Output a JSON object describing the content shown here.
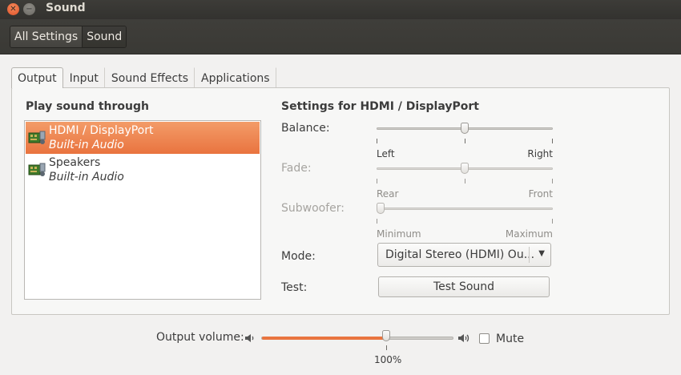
{
  "window": {
    "title": "Sound"
  },
  "breadcrumbs": [
    {
      "label": "All Settings"
    },
    {
      "label": "Sound"
    }
  ],
  "tabs": [
    {
      "label": "Output",
      "selected": true
    },
    {
      "label": "Input",
      "selected": false
    },
    {
      "label": "Sound Effects",
      "selected": false
    },
    {
      "label": "Applications",
      "selected": false
    }
  ],
  "output": {
    "device_heading": "Play sound through",
    "devices": [
      {
        "name": "HDMI / DisplayPort",
        "sub": "Built-in Audio",
        "selected": true,
        "icon": "sound-card-icon"
      },
      {
        "name": "Speakers",
        "sub": "Built-in Audio",
        "selected": false,
        "icon": "sound-card-icon"
      }
    ],
    "settings_heading": "Settings for HDMI / DisplayPort",
    "balance": {
      "label": "Balance:",
      "left": "Left",
      "right": "Right",
      "value": 0.5,
      "enabled": true
    },
    "fade": {
      "label": "Fade:",
      "left": "Rear",
      "right": "Front",
      "value": 0.5,
      "enabled": false
    },
    "subwoofer": {
      "label": "Subwoofer:",
      "left": "Minimum",
      "right": "Maximum",
      "value": 0.0,
      "enabled": false
    },
    "mode": {
      "label": "Mode:",
      "value": "Digital Stereo (HDMI) Ou..."
    },
    "test": {
      "label": "Test:",
      "button": "Test Sound"
    }
  },
  "volume": {
    "label": "Output volume:",
    "percent_label": "100%",
    "value": 0.65,
    "mute_label": "Mute",
    "muted": false
  },
  "colors": {
    "accent": "#e9743f",
    "titlebar": "#3d3c38"
  }
}
